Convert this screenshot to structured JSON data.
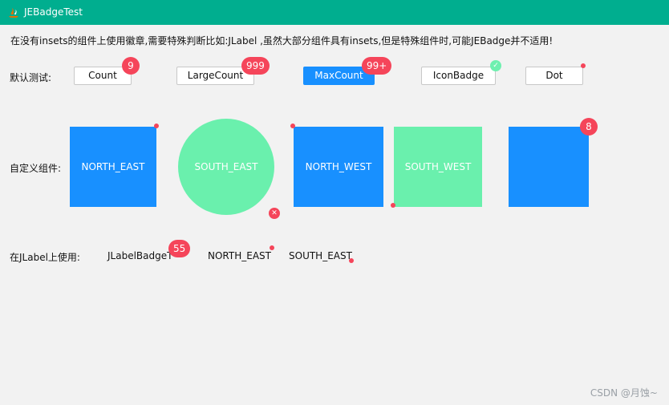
{
  "window": {
    "title": "JEBadgeTest"
  },
  "intro": "在没有insets的组件上使用徽章,需要特殊判断比如:JLabel ,虽然大部分组件具有insets,但是特殊组件时,可能JEBadge并不适用!",
  "default_test": {
    "label": "默认测试:",
    "buttons": [
      {
        "label": "Count",
        "badge": "9"
      },
      {
        "label": "LargeCount",
        "badge": "999"
      },
      {
        "label": "MaxCount",
        "badge": "99+"
      },
      {
        "label": "IconBadge",
        "badge_icon": "check-icon"
      },
      {
        "label": "Dot",
        "badge_icon": "dot"
      }
    ]
  },
  "custom_component": {
    "label": "自定义组件:",
    "blocks": [
      {
        "label": "NORTH_EAST",
        "color": "#1890ff"
      },
      {
        "label": "SOUTH_EAST",
        "color": "#6af0ad",
        "badge_icon": "close-icon"
      },
      {
        "label": "NORTH_WEST",
        "color": "#1890ff"
      },
      {
        "label": "SOUTH_WEST",
        "color": "#6af0ad"
      },
      {
        "label": "",
        "color": "#1890ff",
        "badge": "8"
      }
    ]
  },
  "jlabel": {
    "label": "在JLabel上使用:",
    "items": [
      {
        "label": "JLabelBadgeT",
        "badge": "55"
      },
      {
        "label": "NORTH_EAST"
      },
      {
        "label": "SOUTH_EAST"
      }
    ]
  },
  "footer": "CSDN @月蚀~",
  "colors": {
    "titlebar": "#00ae8f",
    "primary": "#1890ff",
    "badge": "#f5455a",
    "green": "#6af0ad"
  }
}
